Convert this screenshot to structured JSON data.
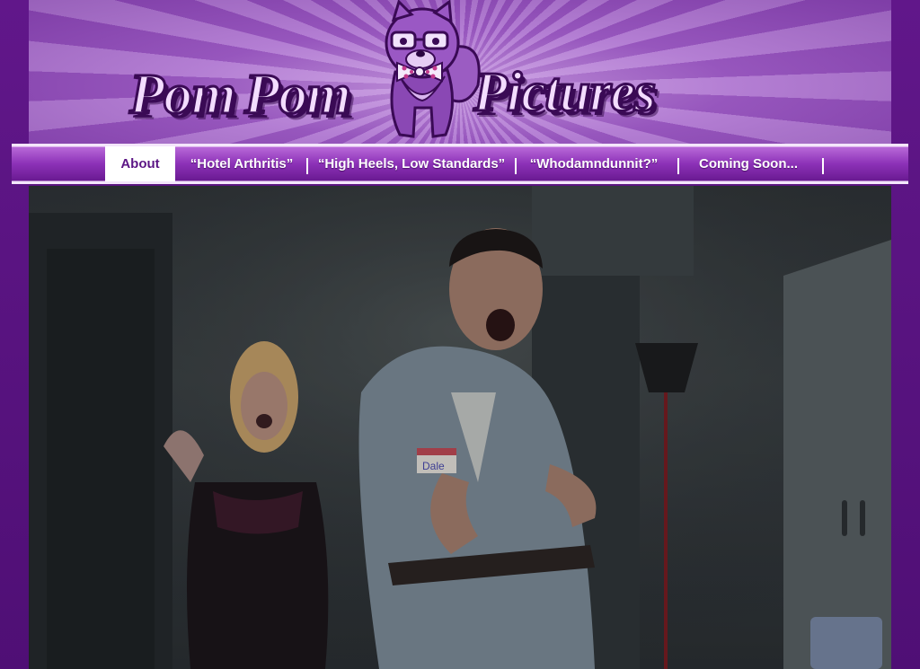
{
  "brand": {
    "word1": "Pom",
    "word2": "Pom",
    "word3": "Pictures"
  },
  "nav": {
    "items": [
      {
        "label": "About",
        "active": true
      },
      {
        "label": "“Hotel Arthritis”",
        "active": false
      },
      {
        "label": "“High Heels, Low Standards”",
        "active": false
      },
      {
        "label": "“Whodamndunnit?”",
        "active": false
      },
      {
        "label": "Coming Soon...",
        "active": false
      }
    ]
  },
  "hero": {
    "name_tag": "Dale"
  },
  "colors": {
    "page_background": "#5a1480",
    "nav_purple": "#8d32b8",
    "active_tab_text": "#5c1685",
    "logo_fill": "#f3dcff",
    "logo_outline": "#3a0a55"
  },
  "icons": {
    "mascot": "pomeranian-dog-with-glasses-and-bowtie"
  }
}
